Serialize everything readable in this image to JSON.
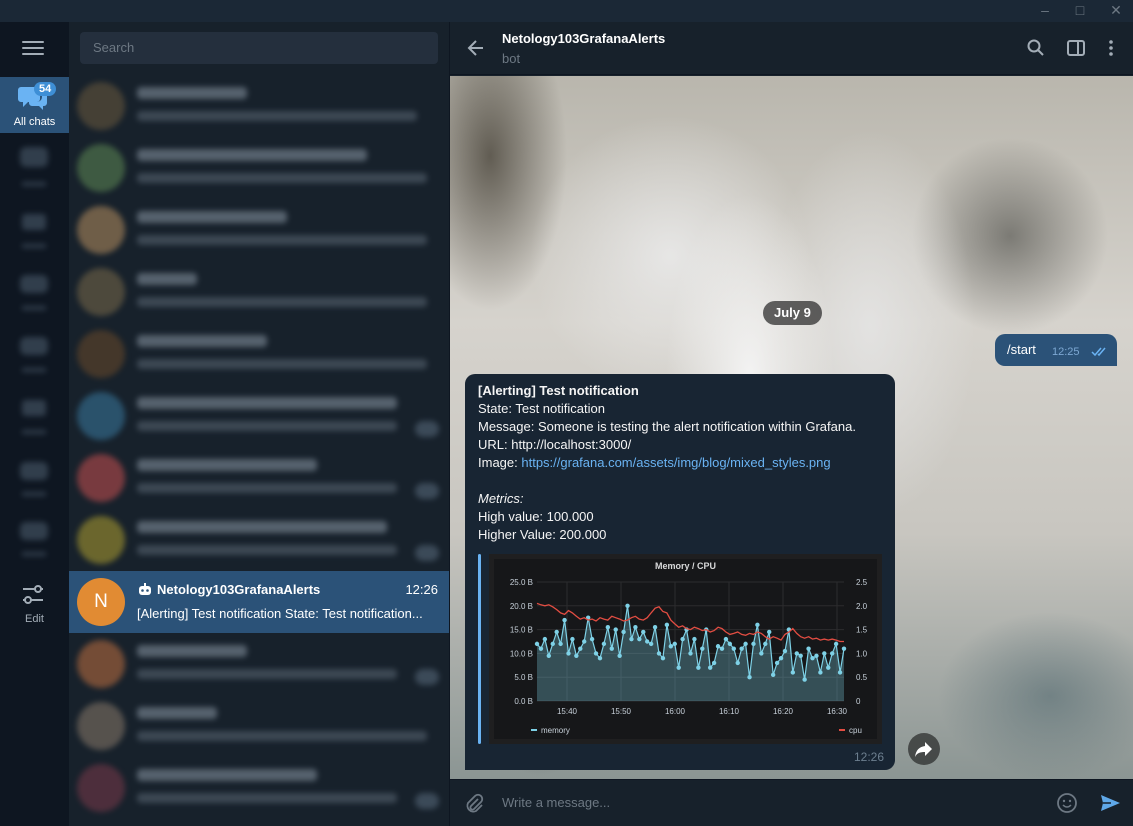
{
  "sidebar": {
    "all_chats_label": "All chats",
    "all_chats_badge": "54",
    "edit_label": "Edit"
  },
  "search": {
    "placeholder": "Search"
  },
  "active_chat": {
    "avatar_letter": "N",
    "name": "Netology103GrafanaAlerts",
    "time": "12:26",
    "preview": "[Alerting] Test notification State: Test notification..."
  },
  "header": {
    "title": "Netology103GrafanaAlerts",
    "subtitle": "bot"
  },
  "messages": {
    "date_separator": "July 9",
    "outgoing": {
      "text": "/start",
      "time": "12:25"
    },
    "incoming": {
      "title": "[Alerting] Test notification",
      "state": "State: Test notification",
      "message": "Message: Someone is testing the alert notification within Grafana.",
      "url": "URL: http://localhost:3000/",
      "image_label": "Image: ",
      "image_link": "https://grafana.com/assets/img/blog/mixed_styles.png",
      "metrics_label": "Metrics:",
      "high_value": "High value: 100.000",
      "higher_value": "Higher Value: 200.000",
      "time": "12:26"
    }
  },
  "composer": {
    "placeholder": "Write a message..."
  },
  "colors": {
    "accent": "#6ab3f3",
    "active_bg": "#2b5278",
    "avatar": "#e18b33",
    "memory_series": "#7ed1e6",
    "cpu_series": "#e24d42"
  },
  "chart_data": {
    "type": "line",
    "title": "Memory / CPU",
    "x": [
      "15:40",
      "15:50",
      "16:00",
      "16:10",
      "16:20",
      "16:30"
    ],
    "y_left_ticks": [
      "0.0 B",
      "5.0 B",
      "10.0 B",
      "15.0 B",
      "20.0 B",
      "25.0 B"
    ],
    "y_right_ticks": [
      "0",
      "0.5",
      "1.0",
      "1.5",
      "2.0",
      "2.5"
    ],
    "ylim_left": [
      0,
      25
    ],
    "ylim_right": [
      0,
      2.5
    ],
    "legend_position": "bottom",
    "series": [
      {
        "name": "memory",
        "axis": "left",
        "values": [
          12,
          11,
          13,
          9.5,
          12,
          14.5,
          12,
          17,
          10,
          13,
          9.5,
          11,
          12.5,
          17.5,
          13,
          10,
          9,
          12,
          15.5,
          11,
          15,
          9.5,
          14.5,
          20,
          13,
          15.5,
          13,
          14.5,
          12.5,
          12,
          15.5,
          10,
          9,
          16,
          11.5,
          12,
          7,
          13,
          15,
          10,
          13,
          7,
          11,
          15,
          7,
          8,
          11.5,
          11,
          13,
          12,
          11,
          8,
          11,
          12,
          5,
          12,
          16,
          10,
          12,
          14.5,
          5.5,
          8,
          9,
          10.5,
          15,
          6,
          10,
          9.5,
          4.5,
          11,
          9,
          9.5,
          6,
          10,
          7,
          10,
          12,
          6,
          11
        ]
      },
      {
        "name": "cpu",
        "axis": "right",
        "values": [
          2.05,
          2.02,
          2.0,
          2.02,
          1.98,
          1.92,
          1.85,
          1.82,
          1.9,
          1.85,
          1.78,
          1.72,
          1.75,
          1.7,
          1.72,
          1.68,
          1.75,
          1.72,
          1.7,
          1.78,
          1.75,
          1.72,
          1.68,
          1.7,
          1.75,
          1.78,
          1.72,
          1.7,
          1.75,
          1.85,
          1.95,
          1.98,
          1.88,
          1.85,
          1.7,
          1.62,
          1.55,
          1.58,
          1.52,
          1.5,
          1.55,
          1.52,
          1.48,
          1.5,
          1.45,
          1.48,
          1.55,
          1.52,
          1.45,
          1.4,
          1.42,
          1.45,
          1.4,
          1.38,
          1.42,
          1.4,
          1.45,
          1.42,
          1.35,
          1.3,
          1.35,
          1.32,
          1.28,
          1.4,
          1.45,
          1.52,
          1.42,
          1.35,
          1.32,
          1.35,
          1.3,
          1.32,
          1.28,
          1.3,
          1.28,
          1.3,
          1.28,
          1.25,
          1.25
        ]
      }
    ]
  }
}
